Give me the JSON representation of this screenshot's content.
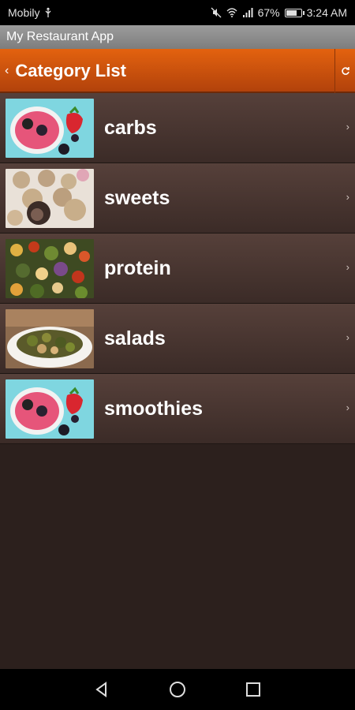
{
  "status_bar": {
    "carrier": "Mobily",
    "battery": "67%",
    "time": "3:24 AM",
    "battery_level": 0.67
  },
  "app_bar": {
    "title": "My Restaurant App"
  },
  "nav": {
    "title": "Category List"
  },
  "categories": [
    {
      "label": "carbs",
      "image": "berry-smoothie-photo"
    },
    {
      "label": "sweets",
      "image": "cookie-balls-photo"
    },
    {
      "label": "protein",
      "image": "roasted-vegetables-photo"
    },
    {
      "label": "salads",
      "image": "brussels-sprouts-plate-photo"
    },
    {
      "label": "smoothies",
      "image": "berry-smoothie-photo"
    }
  ],
  "colors": {
    "accent": "#d9580d",
    "row_bg": "#4a3631",
    "page_bg": "#2c201d"
  }
}
